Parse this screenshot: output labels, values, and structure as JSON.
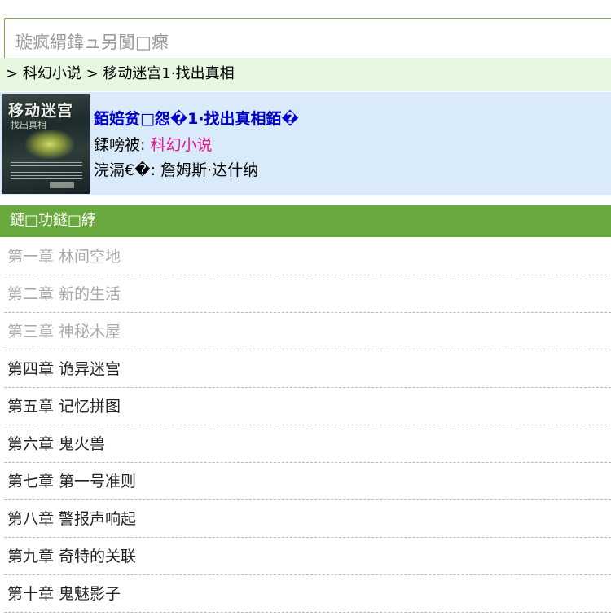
{
  "search": {
    "placeholder": "璇疯緭鍏ュ另闅□瘝"
  },
  "breadcrumb": {
    "separator": ">",
    "items": [
      "科幻小说",
      "移动迷宫1·找出真相"
    ]
  },
  "book": {
    "cover_title": "移动迷宫",
    "cover_subtitle": "找出真相",
    "title": "銆婄贫□怨�1·找出真相銆�",
    "category_label": "鍒嗙被:",
    "category_value": "科幻小说",
    "author_label": "浣滆€�:",
    "author_value": "詹姆斯·达什纳"
  },
  "chapters_header": "鏈□功鐩□綍",
  "chapters": [
    {
      "label": "第一章 林间空地",
      "state": "read"
    },
    {
      "label": "第二章 新的生活",
      "state": "read"
    },
    {
      "label": "第三章 神秘木屋",
      "state": "read"
    },
    {
      "label": "第四章 诡异迷宫",
      "state": "unread"
    },
    {
      "label": "第五章 记忆拼图",
      "state": "unread"
    },
    {
      "label": "第六章 鬼火兽",
      "state": "unread"
    },
    {
      "label": "第七章 第一号准则",
      "state": "unread"
    },
    {
      "label": "第八章 警报声响起",
      "state": "unread"
    },
    {
      "label": "第九章 奇特的关联",
      "state": "unread"
    },
    {
      "label": "第十章 鬼魅影子",
      "state": "unread"
    }
  ],
  "colors": {
    "breadcrumb_bg": "#e6f7e0",
    "book_info_bg": "#d9ebfb",
    "header_bg": "#69a83d",
    "title_link": "#0000cc",
    "category_link": "#e8158c",
    "read_chapter": "#a9a9a9",
    "unread_chapter": "#222222"
  }
}
